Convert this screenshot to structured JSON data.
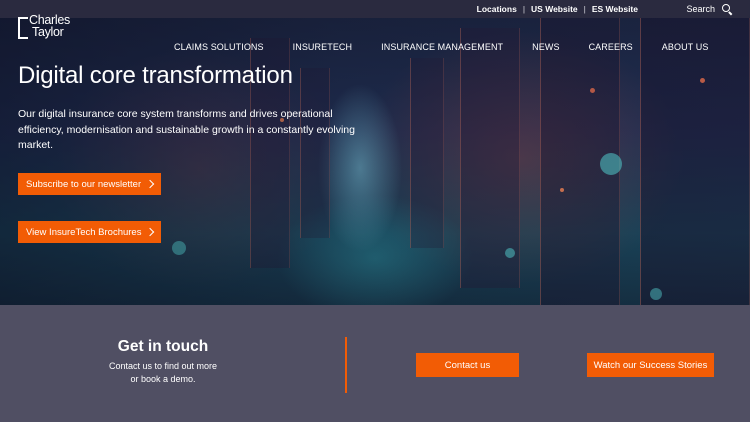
{
  "topbar": {
    "links": [
      "Locations",
      "US Website",
      "ES Website"
    ],
    "separator": "|",
    "search_label": "Search"
  },
  "logo": {
    "line1": "Charles",
    "line2": "Taylor"
  },
  "nav": {
    "items": [
      "CLAIMS SOLUTIONS",
      "INSURETECH",
      "INSURANCE MANAGEMENT",
      "NEWS",
      "CAREERS",
      "ABOUT US"
    ]
  },
  "hero": {
    "title": "Digital core transformation",
    "description": "Our digital insurance core system transforms and drives operational efficiency, modernisation and sustainable growth in a constantly evolving market.",
    "cta_newsletter": "Subscribe to our newsletter",
    "cta_brochures": "View InsureTech Brochures"
  },
  "contact": {
    "title": "Get in touch",
    "description_line1": "Contact us to find out more",
    "description_line2": "or book a demo.",
    "contact_button": "Contact us",
    "stories_button": "Watch our Success Stories"
  },
  "colors": {
    "accent": "#f25c05",
    "topbar": "#2a2a3f",
    "band": "#504f63"
  },
  "icons": {
    "search": "search-icon",
    "cta_arrow": "chevron-right-icon"
  }
}
